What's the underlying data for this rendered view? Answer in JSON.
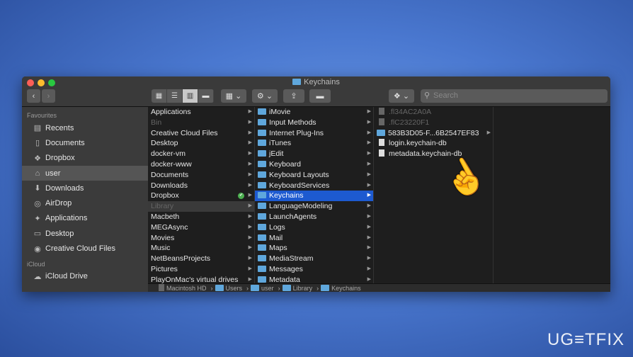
{
  "window": {
    "title": "Keychains"
  },
  "toolbar": {
    "back": "‹",
    "forward": "›",
    "search_placeholder": "Search"
  },
  "sidebar": {
    "favourites_label": "Favourites",
    "items": [
      {
        "label": "Recents",
        "icon": "▤"
      },
      {
        "label": "Documents",
        "icon": "▯"
      },
      {
        "label": "Dropbox",
        "icon": "❖"
      },
      {
        "label": "user",
        "icon": "⌂"
      },
      {
        "label": "Downloads",
        "icon": "⬇"
      },
      {
        "label": "AirDrop",
        "icon": "◎"
      },
      {
        "label": "Applications",
        "icon": "✦"
      },
      {
        "label": "Desktop",
        "icon": "▭"
      },
      {
        "label": "Creative Cloud Files",
        "icon": "◉"
      }
    ],
    "icloud_label": "iCloud",
    "icloud_items": [
      {
        "label": "iCloud Drive",
        "icon": "☁"
      }
    ]
  },
  "columns": {
    "col1": [
      "Applications",
      "Bin",
      "Creative Cloud Files",
      "Desktop",
      "docker-vm",
      "docker-www",
      "Documents",
      "Downloads",
      "Dropbox",
      "Library",
      "Macbeth",
      "MEGAsync",
      "Movies",
      "Music",
      "NetBeansProjects",
      "Pictures",
      "PlayOnMac's virtual drives"
    ],
    "col2": [
      "iMovie",
      "Input Methods",
      "Internet Plug-Ins",
      "iTunes",
      "jEdit",
      "Keyboard",
      "Keyboard Layouts",
      "KeyboardServices",
      "Keychains",
      "LanguageModeling",
      "LaunchAgents",
      "Logs",
      "Mail",
      "Maps",
      "MediaStream",
      "Messages",
      "Metadata"
    ],
    "col3": [
      ".fl34AC2A0A",
      ".flC23220F1",
      "583B3D05-F...6B2547EF83",
      "login.keychain-db",
      "metadata.keychain-db"
    ]
  },
  "pathbar": [
    "Macintosh HD",
    "Users",
    "user",
    "Library",
    "Keychains"
  ],
  "watermark": "UG≡TFIX",
  "colors": {
    "selection": "#1d5ad0",
    "folder": "#5fa7dc",
    "sync_ok": "#4caf50"
  }
}
